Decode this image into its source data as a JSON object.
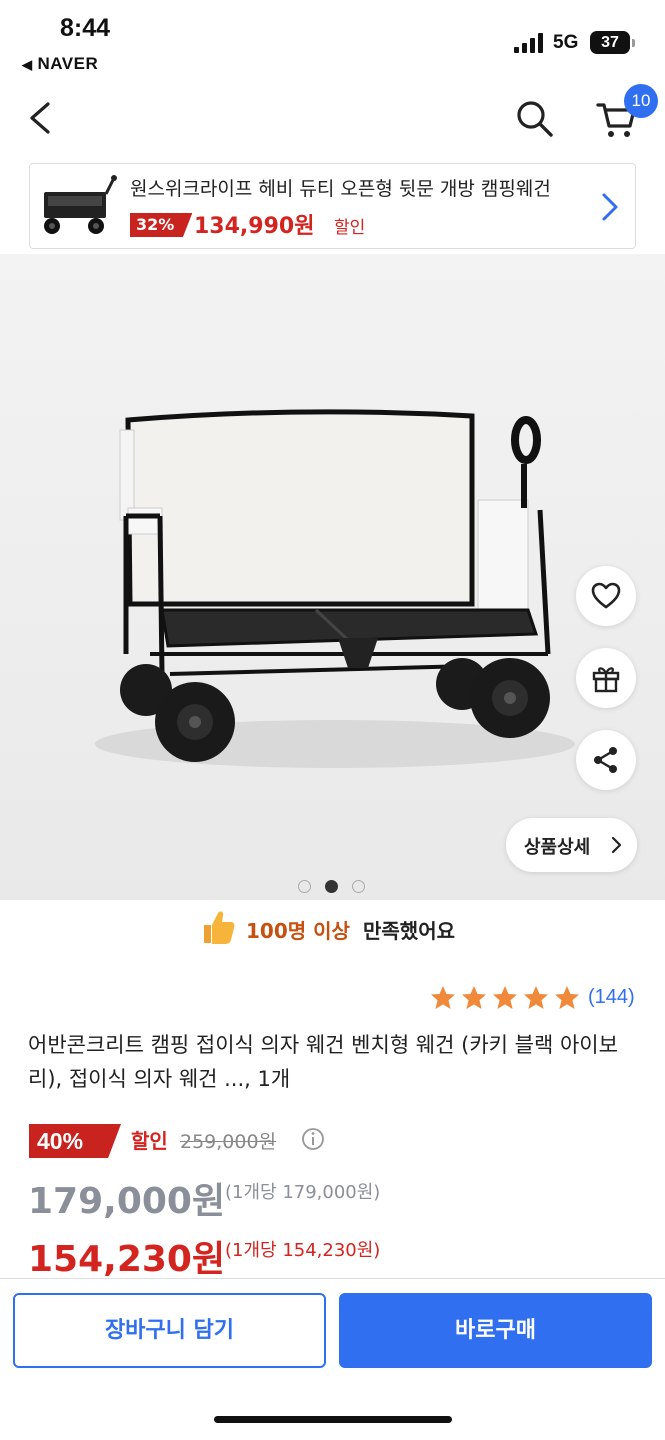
{
  "status_bar": {
    "time": "8:44",
    "back_app": "NAVER",
    "network": "5G",
    "battery": "37"
  },
  "nav": {
    "cart_count": "10"
  },
  "promo": {
    "title": "원스위크라이프 헤비 듀티 오픈형 뒷문 개방 캠핑웨건",
    "discount": "32%",
    "price": "134,990원",
    "sale_label": "할인"
  },
  "gallery": {
    "detail_label": "상품상세",
    "page_count": 3,
    "current_page": 2
  },
  "satisfaction": {
    "highlight": "100명 이상",
    "rest": "만족했어요"
  },
  "rating": {
    "stars": 5,
    "review_count": "(144)"
  },
  "product": {
    "title": "어반콘크리트 캠핑 접이식 의자 웨건 벤치형 웨건 (카키 블랙 아이보리), 접이식 의자 웨건 ..., 1개"
  },
  "pricing": {
    "discount_badge": "40%",
    "discount_label": "할인",
    "original_price": "259,000원",
    "mid_price": "179,000원",
    "mid_unit": "(1개당 179,000원)",
    "final_price": "154,230원",
    "final_unit": "(1개당 154,230원)"
  },
  "actions": {
    "add_to_cart": "장바구니 담기",
    "buy_now": "바로구매"
  },
  "colors": {
    "accent_blue": "#2f6ff0",
    "sale_red": "#d3241f",
    "badge_red": "#c8231f",
    "star_orange": "#f08a3a",
    "highlight_orange": "#c65010"
  },
  "icons": {
    "back": "chevron-left-icon",
    "search": "search-icon",
    "cart": "cart-icon",
    "heart": "heart-icon",
    "gift": "gift-icon",
    "share": "share-icon",
    "thumbs_up": "thumbs-up-icon",
    "info": "info-icon"
  }
}
